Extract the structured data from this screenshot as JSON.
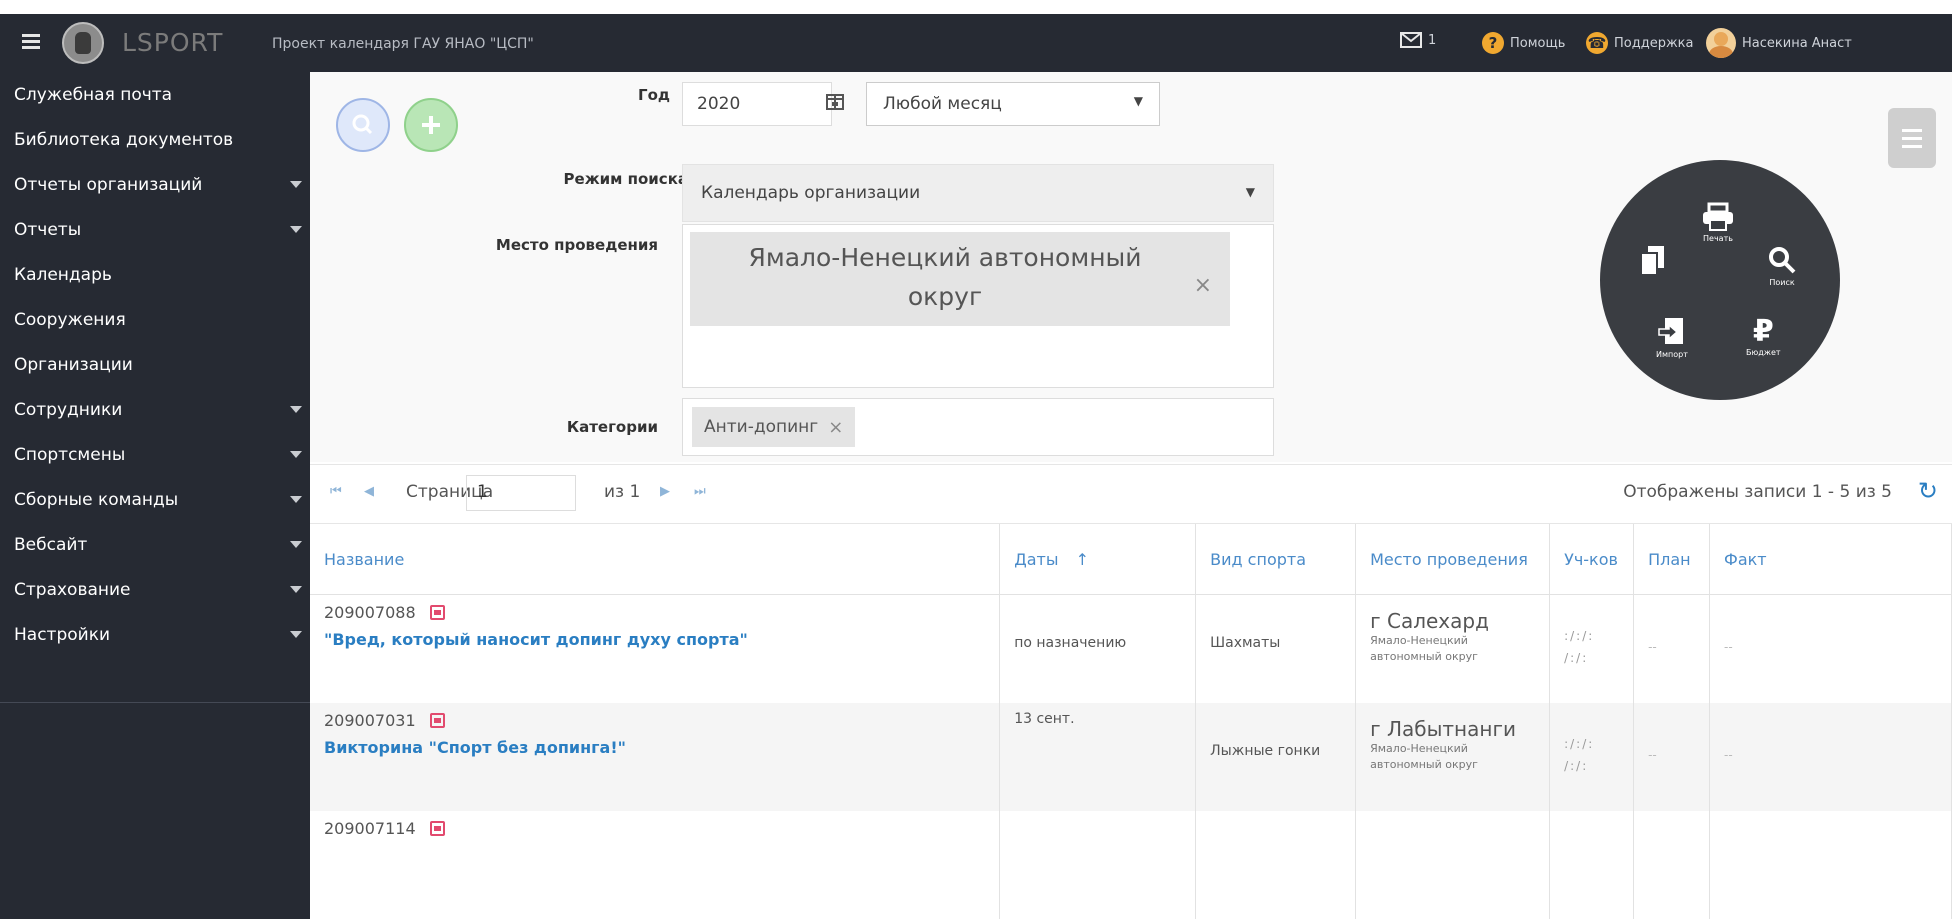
{
  "header": {
    "logo_text": "LSPORT",
    "project_title": "Проект календаря ГАУ ЯНАО \"ЦСП\"",
    "mail_count": "1",
    "help_label": "Помощь",
    "support_label": "Поддержка",
    "user_name": "Насекина Анаст"
  },
  "sidebar": {
    "items": [
      {
        "label": "Служебная почта",
        "has_caret": false
      },
      {
        "label": "Библиотека документов",
        "has_caret": false
      },
      {
        "label": "Отчеты организаций",
        "has_caret": true
      },
      {
        "label": "Отчеты",
        "has_caret": true
      },
      {
        "label": "Календарь",
        "has_caret": false
      },
      {
        "label": "Сооружения",
        "has_caret": false
      },
      {
        "label": "Организации",
        "has_caret": false
      },
      {
        "label": "Сотрудники",
        "has_caret": true
      },
      {
        "label": "Спортсмены",
        "has_caret": true
      },
      {
        "label": "Сборные команды",
        "has_caret": true
      },
      {
        "label": "Вебсайт",
        "has_caret": true
      },
      {
        "label": "Страхование",
        "has_caret": true
      },
      {
        "label": "Настройки",
        "has_caret": true
      }
    ]
  },
  "filter": {
    "year_label": "Год",
    "year_value": "2020",
    "month_value": "Любой месяц",
    "mode_label": "Режим поиска",
    "mode_value": "Календарь организации",
    "place_label": "Место проведения",
    "place_tag": "Ямало-Ненецкий автономный округ",
    "categories_label": "Категории",
    "category_chip": "Анти-допинг"
  },
  "wheel": {
    "print_label": "Печать",
    "search_label": "Поиск",
    "import_label": "Импорт",
    "budget_label": "Бюджет"
  },
  "pager": {
    "page_label": "Страница",
    "page_value": "1",
    "of_label": "из 1",
    "records_label": "Отображены записи 1 - 5 из 5"
  },
  "table": {
    "headers": [
      "Название",
      "Даты",
      "Вид спорта",
      "Место проведения",
      "Уч-ков",
      "План",
      "Факт"
    ],
    "sort_indicator": "↑",
    "rows": [
      {
        "code": "209007088",
        "title": "\"Вред, который наносит допинг духу спорта\"",
        "dates": "по назначению",
        "sport": "Шахматы",
        "city": "г Салехард",
        "region": "Ямало-Ненецкий автономный округ",
        "ucs1": ":/:/:",
        "ucs2": "/:/:",
        "plan": "--",
        "fact": "--"
      },
      {
        "code": "209007031",
        "title": "Викторина \"Спорт без допинга!\"",
        "dates": "13 сент.",
        "sport": "Лыжные гонки",
        "city": "г Лабытнанги",
        "region": "Ямало-Ненецкий автономный округ",
        "ucs1": ":/:/:",
        "ucs2": "/:/:",
        "plan": "--",
        "fact": "--"
      },
      {
        "code": "209007114",
        "title": "",
        "dates": "",
        "sport": "",
        "city": "",
        "region": "",
        "ucs1": "",
        "ucs2": "",
        "plan": "",
        "fact": ""
      }
    ]
  },
  "colors": {
    "sidebar_bg": "#262a33",
    "link_blue": "#2a7ec2",
    "search_btn": "#9fb6e6",
    "add_btn": "#8fd18b",
    "calendar_icon": "#e24a6e"
  }
}
